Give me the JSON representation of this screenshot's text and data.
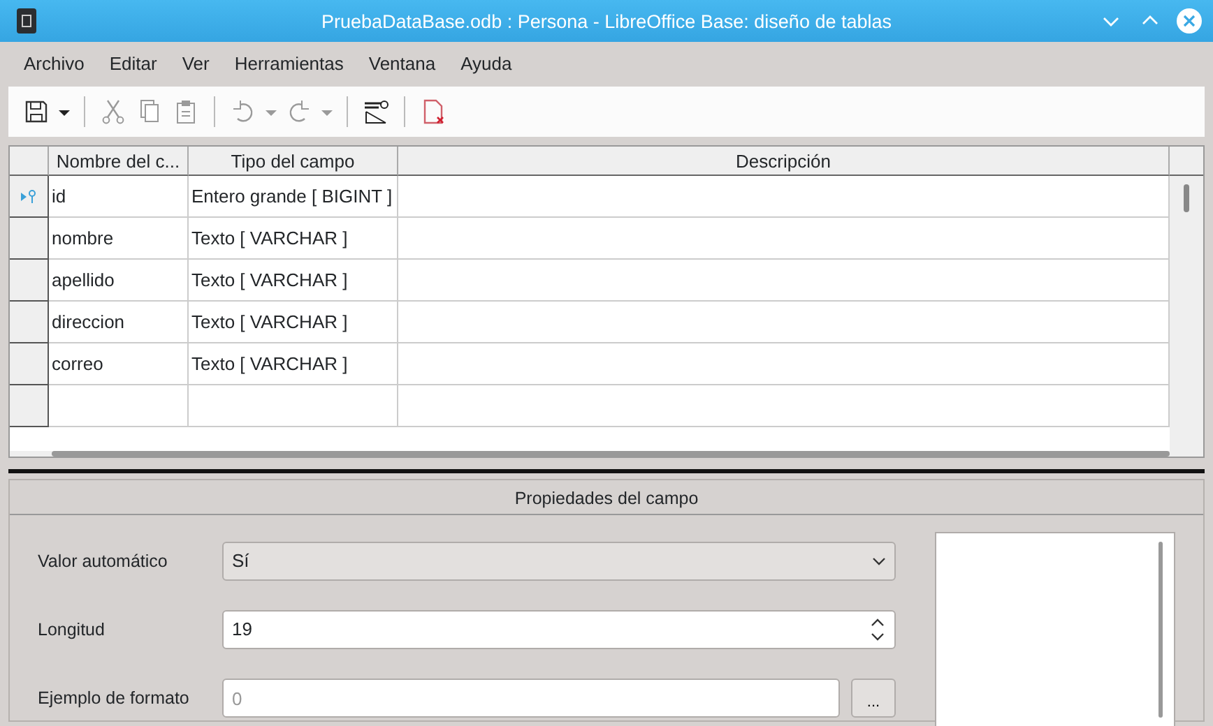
{
  "window": {
    "title": "PruebaDataBase.odb : Persona - LibreOffice Base: diseño de tablas"
  },
  "menu": [
    "Archivo",
    "Editar",
    "Ver",
    "Herramientas",
    "Ventana",
    "Ayuda"
  ],
  "table": {
    "columns": [
      "Nombre del c...",
      "Tipo del campo",
      "Descripción"
    ],
    "rows": [
      {
        "name": "id",
        "type": "Entero grande [ BIGINT ]",
        "primary_key": true
      },
      {
        "name": "nombre",
        "type": "Texto [ VARCHAR ]",
        "primary_key": false
      },
      {
        "name": "apellido",
        "type": "Texto [ VARCHAR ]",
        "primary_key": false
      },
      {
        "name": "direccion",
        "type": "Texto [ VARCHAR ]",
        "primary_key": false
      },
      {
        "name": "correo",
        "type": "Texto [ VARCHAR ]",
        "primary_key": false
      }
    ]
  },
  "properties": {
    "title": "Propiedades del campo",
    "fields": [
      {
        "kind": "dropdown",
        "label": "Valor automático",
        "value": "Sí"
      },
      {
        "kind": "spin",
        "label": "Longitud",
        "value": "19"
      },
      {
        "kind": "button",
        "label": "Ejemplo de formato",
        "placeholder": "0",
        "button": "..."
      }
    ]
  }
}
